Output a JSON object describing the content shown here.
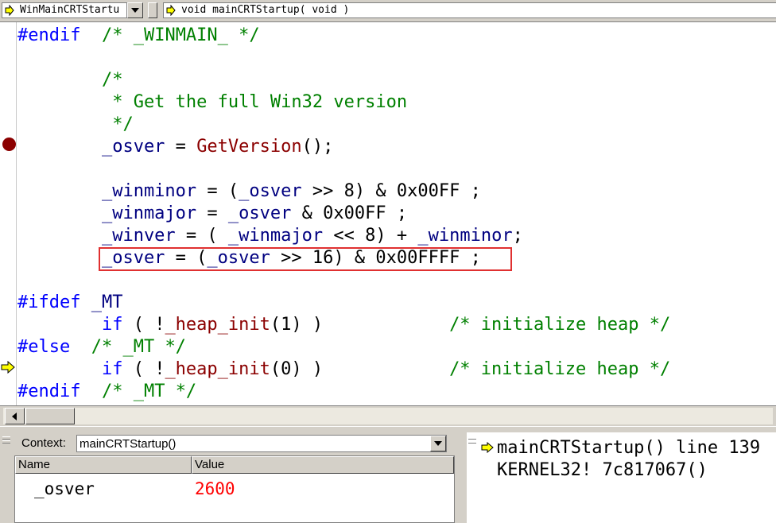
{
  "toolbar": {
    "class_combo": "WinMainCRTStartu",
    "function_combo": "void mainCRTStartup( void )"
  },
  "editor": {
    "lines": [
      [
        {
          "t": "#endif",
          "c": "kw"
        },
        {
          "t": "  /* _WINMAIN_ */",
          "c": "cm"
        }
      ],
      [],
      [
        {
          "t": "        /*",
          "c": "cm"
        }
      ],
      [
        {
          "t": "         * Get the full Win32 version",
          "c": "cm"
        }
      ],
      [
        {
          "t": "         */",
          "c": "cm"
        }
      ],
      [
        {
          "t": "        _osver",
          "c": "id"
        },
        {
          "t": " = ",
          "c": "tx"
        },
        {
          "t": "GetVersion",
          "c": "fn"
        },
        {
          "t": "();",
          "c": "tx"
        }
      ],
      [],
      [
        {
          "t": "        _winminor",
          "c": "id"
        },
        {
          "t": " = (",
          "c": "tx"
        },
        {
          "t": "_osver",
          "c": "id"
        },
        {
          "t": " >> 8) & 0x00FF ;",
          "c": "tx"
        }
      ],
      [
        {
          "t": "        _winmajor",
          "c": "id"
        },
        {
          "t": " = ",
          "c": "tx"
        },
        {
          "t": "_osver",
          "c": "id"
        },
        {
          "t": " & 0x00FF ;",
          "c": "tx"
        }
      ],
      [
        {
          "t": "        _winver",
          "c": "id"
        },
        {
          "t": " = ( ",
          "c": "tx"
        },
        {
          "t": "_winmajor",
          "c": "id"
        },
        {
          "t": " << 8) + ",
          "c": "tx"
        },
        {
          "t": "_winminor",
          "c": "id"
        },
        {
          "t": ";",
          "c": "tx"
        }
      ],
      [
        {
          "t": "        _osver",
          "c": "id"
        },
        {
          "t": " = (",
          "c": "tx"
        },
        {
          "t": "_osver",
          "c": "id"
        },
        {
          "t": " >> 16) & 0x00FFFF ;",
          "c": "tx"
        }
      ],
      [],
      [
        {
          "t": "#ifdef",
          "c": "kw"
        },
        {
          "t": " _MT",
          "c": "id"
        }
      ],
      [
        {
          "t": "        if",
          "c": "kw"
        },
        {
          "t": " ( !",
          "c": "tx"
        },
        {
          "t": "_heap_init",
          "c": "fn"
        },
        {
          "t": "(1) )",
          "c": "tx"
        },
        {
          "t": "            /* initialize heap */",
          "c": "cm"
        }
      ],
      [
        {
          "t": "#else",
          "c": "kw"
        },
        {
          "t": "  /* _MT */",
          "c": "cm"
        }
      ],
      [
        {
          "t": "        if",
          "c": "kw"
        },
        {
          "t": " ( !",
          "c": "tx"
        },
        {
          "t": "_heap_init",
          "c": "fn"
        },
        {
          "t": "(0) )",
          "c": "tx"
        },
        {
          "t": "            /* initialize heap */",
          "c": "cm"
        }
      ],
      [
        {
          "t": "#endif",
          "c": "kw"
        },
        {
          "t": "  /* _MT */",
          "c": "cm"
        }
      ]
    ]
  },
  "context": {
    "label": "Context:",
    "value": "mainCRTStartup()"
  },
  "variables": {
    "headers": [
      "Name",
      "Value"
    ],
    "rows": [
      {
        "name": "_osver",
        "value": "2600"
      }
    ]
  },
  "call_stack": [
    "mainCRTStartup() line 139",
    "KERNEL32! 7c817067()"
  ],
  "colors": {
    "keyword": "#0000ff",
    "comment": "#008000",
    "identifier": "#000080",
    "function": "#8b0000",
    "changed_value": "#ff0000",
    "highlight_box": "#e03030"
  },
  "icons": [
    "current-statement-arrow-icon",
    "breakpoint-icon",
    "dropdown-arrow-icon",
    "scroll-left-icon"
  ]
}
